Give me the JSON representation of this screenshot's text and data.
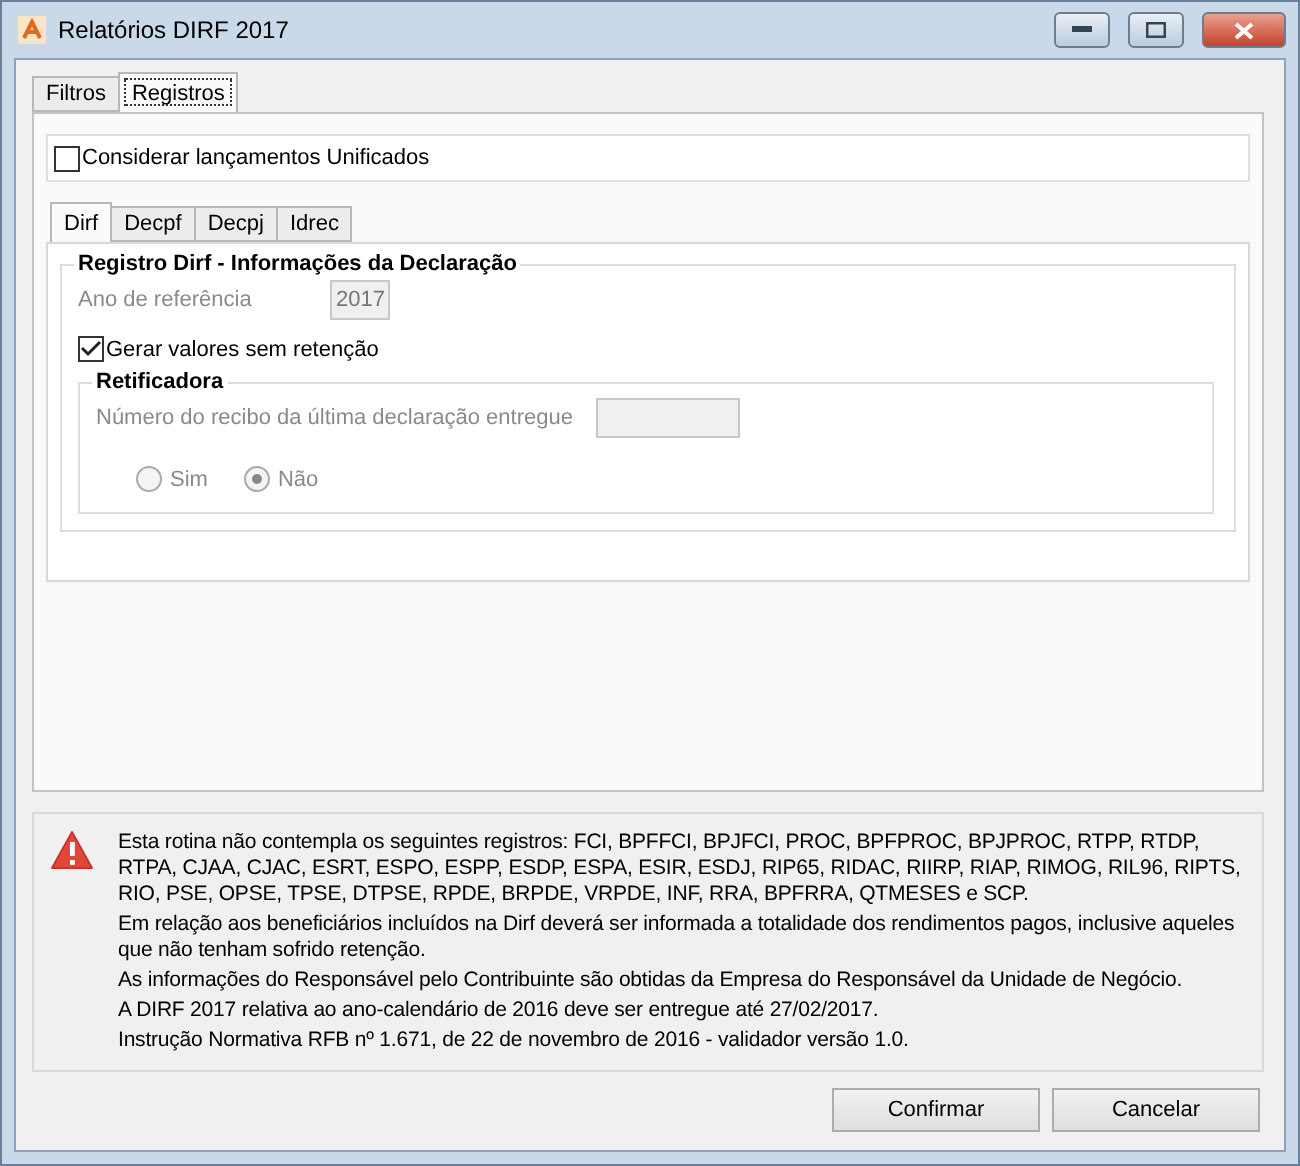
{
  "window": {
    "title": "Relatórios DIRF 2017"
  },
  "tabs": [
    {
      "label": "Filtros",
      "selected": false
    },
    {
      "label": "Registros",
      "selected": true
    }
  ],
  "unified": {
    "label": "Considerar lançamentos Unificados",
    "checked": false
  },
  "subtabs": [
    {
      "label": "Dirf",
      "selected": true
    },
    {
      "label": "Decpf",
      "selected": false
    },
    {
      "label": "Decpj",
      "selected": false
    },
    {
      "label": "Idrec",
      "selected": false
    }
  ],
  "group": {
    "title": "Registro Dirf - Informações da Declaração",
    "year_label": "Ano de referência",
    "year_value": "2017",
    "generate": {
      "label": "Gerar valores sem retenção",
      "checked": true
    },
    "retificadora": {
      "title": "Retificadora",
      "receipt_label": "Número do recibo da última declaração entregue",
      "radios": [
        {
          "label": "Sim",
          "selected": false
        },
        {
          "label": "Não",
          "selected": true
        }
      ]
    }
  },
  "notice": [
    "Esta rotina não contempla os seguintes registros: FCI, BPFFCI, BPJFCI, PROC, BPFPROC, BPJPROC, RTPP, RTDP, RTPA, CJAA, CJAC, ESRT, ESPO, ESPP, ESDP, ESPA, ESIR, ESDJ, RIP65, RIDAC, RIIRP, RIAP, RIMOG, RIL96, RIPTS, RIO, PSE, OPSE, TPSE, DTPSE, RPDE, BRPDE, VRPDE, INF, RRA, BPFRRA, QTMESES e SCP.",
    "Em relação aos beneficiários incluídos na Dirf deverá ser informada a totalidade dos rendimentos pagos, inclusive aqueles que não tenham sofrido retenção.",
    "As informações do Responsável pelo Contribuinte são obtidas da Empresa do Responsável da Unidade de Negócio.",
    "A DIRF 2017 relativa ao ano-calendário de 2016 deve ser entregue até 27/02/2017.",
    "Instrução Normativa RFB nº 1.671, de 22 de novembro de 2016 - validador versão 1.0."
  ],
  "buttons": [
    "Confirmar",
    "Cancelar"
  ]
}
